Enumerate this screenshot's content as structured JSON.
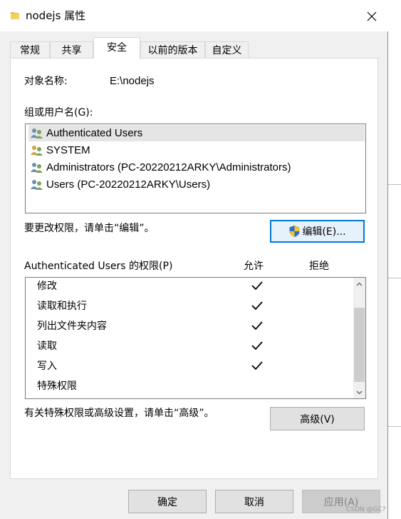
{
  "window": {
    "title": "nodejs 属性",
    "title_icon": "folder-icon",
    "close_icon": "close-icon"
  },
  "tabs": [
    {
      "label": "常规",
      "active": false
    },
    {
      "label": "共享",
      "active": false
    },
    {
      "label": "安全",
      "active": true
    },
    {
      "label": "以前的版本",
      "active": false
    },
    {
      "label": "自定义",
      "active": false
    }
  ],
  "security": {
    "object_name_label": "对象名称:",
    "object_name_value": "E:\\nodejs",
    "groups_label": "组或用户名(G):",
    "groups": [
      {
        "name": "Authenticated Users",
        "selected": true
      },
      {
        "name": "SYSTEM",
        "selected": false
      },
      {
        "name": "Administrators (PC-20220212ARKY\\Administrators)",
        "selected": false
      },
      {
        "name": "Users (PC-20220212ARKY\\Users)",
        "selected": false
      }
    ],
    "change_hint": "要更改权限，请单击“编辑”。",
    "edit_button": "编辑(E)...",
    "permissions_label": "Authenticated Users 的权限(P)",
    "allow_header": "允许",
    "deny_header": "拒绝",
    "permissions": [
      {
        "name": "修改",
        "allow": true,
        "deny": false
      },
      {
        "name": "读取和执行",
        "allow": true,
        "deny": false
      },
      {
        "name": "列出文件夹内容",
        "allow": true,
        "deny": false
      },
      {
        "name": "读取",
        "allow": true,
        "deny": false
      },
      {
        "name": "写入",
        "allow": true,
        "deny": false
      },
      {
        "name": "特殊权限",
        "allow": false,
        "deny": false
      }
    ],
    "advanced_hint": "有关特殊权限或高级设置，请单击“高级”。",
    "advanced_button": "高级(V)"
  },
  "footer": {
    "ok": "确定",
    "cancel": "取消",
    "apply": "应用(A)"
  },
  "watermark": "CSDN @GC?"
}
